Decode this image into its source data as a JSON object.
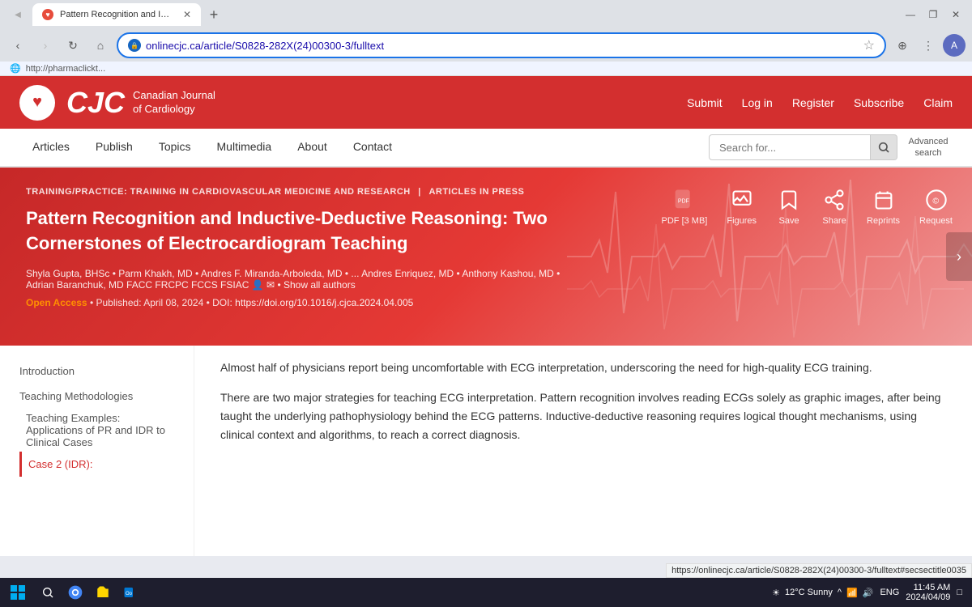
{
  "browser": {
    "tab_title": "Pattern Recognition and Induc...",
    "url": "onlinecjc.ca/article/S0828-282X(24)00300-3/fulltext",
    "favicon_text": "🫀"
  },
  "window_controls": {
    "minimize": "—",
    "maximize": "❐",
    "close": "✕"
  },
  "header": {
    "logo_cjc": "CJC",
    "logo_title_line1": "Canadian Journal",
    "logo_title_line2": "of Cardiology",
    "nav_submit": "Submit",
    "nav_login": "Log in",
    "nav_register": "Register",
    "nav_subscribe": "Subscribe",
    "nav_claim": "Claim"
  },
  "nav": {
    "items": [
      "Articles",
      "Publish",
      "Topics",
      "Multimedia",
      "About",
      "Contact"
    ],
    "search_placeholder": "Search for...",
    "advanced_search": "Advanced search"
  },
  "hero": {
    "breadcrumb_part1": "TRAINING/PRACTICE: TRAINING IN CARDIOVASCULAR MEDICINE AND RESEARCH",
    "breadcrumb_sep": "|",
    "breadcrumb_part2": "ARTICLES IN PRESS",
    "title": "Pattern Recognition and Inductive-Deductive Reasoning: Two Cornerstones of Electrocardiogram Teaching",
    "authors": "Shyla Gupta, BHSc • Parm Khakh, MD • Andres F. Miranda-Arboleda, MD • ... Andres Enriquez, MD • Anthony Kashou, MD • Adrian Baranchuk, MD FACC FRCPC FCCS FSIAC",
    "show_all": "Show all authors",
    "open_access": "Open Access",
    "published": "Published: April 08, 2024",
    "doi_label": "DOI:",
    "doi": "https://doi.org/10.1016/j.cjca.2024.04.005"
  },
  "action_icons": [
    {
      "id": "pdf",
      "label": "PDF [3 MB]",
      "icon": "📄"
    },
    {
      "id": "figures",
      "label": "Figures",
      "icon": "🖼"
    },
    {
      "id": "save",
      "label": "Save",
      "icon": "🔖"
    },
    {
      "id": "share",
      "label": "Share",
      "icon": "🔗"
    },
    {
      "id": "reprints",
      "label": "Reprints",
      "icon": "📋"
    },
    {
      "id": "request",
      "label": "Request",
      "icon": "©"
    }
  ],
  "sidebar": {
    "items": [
      {
        "label": "Introduction",
        "active": false
      },
      {
        "label": "Teaching Methodologies",
        "active": false
      },
      {
        "label": "Teaching Examples: Applications of PR and IDR to Clinical Cases",
        "active": false
      },
      {
        "label": "Case 2 (IDR):",
        "active": true
      }
    ]
  },
  "content": {
    "para1": "Almost half of physicians report being uncomfortable with ECG interpretation, underscoring the need for high-quality ECG training.",
    "para2": "There are two major strategies for teaching ECG interpretation. Pattern recognition involves reading ECGs solely as graphic images, after being taught the underlying pathophysiology behind the ECG patterns. Inductive-deductive reasoning requires logical thought mechanisms, using clinical context and algorithms, to reach a correct diagnosis."
  },
  "status_bar": {
    "url": "https://onlinecjc.ca/article/S0828-282X(24)00300-3/fulltext#secsectitle0035"
  },
  "taskbar": {
    "time": "11:45 AM",
    "date": "2024/04/09",
    "weather": "12°C Sunny",
    "language": "ENG"
  }
}
